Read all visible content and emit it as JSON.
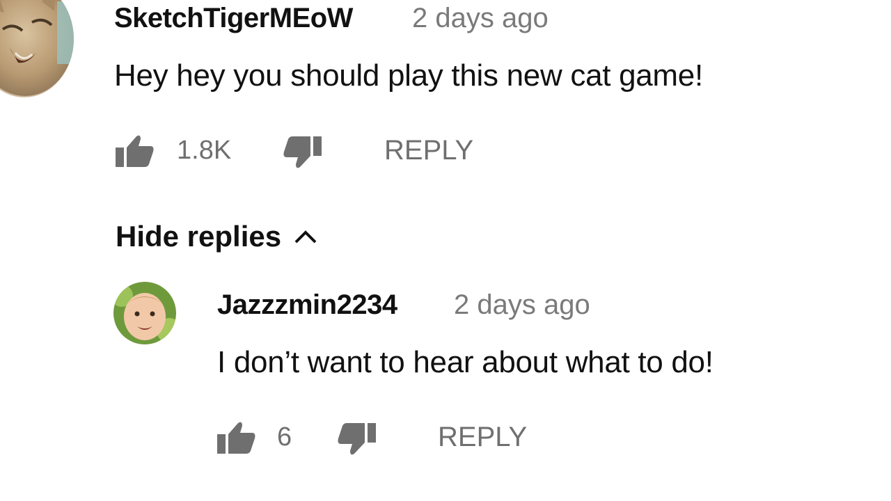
{
  "comment": {
    "author": "SketchTigerMEoW",
    "time": "2 days ago",
    "text": "Hey hey you should play this new cat game!",
    "likes": "1.8K",
    "reply_label": "REPLY",
    "avatar_icon": "cat-avatar-icon"
  },
  "replies_toggle": {
    "label": "Hide replies",
    "icon": "chevron-up-icon"
  },
  "reply": {
    "author": "Jazzzmin2234",
    "time": "2 days ago",
    "text": "I don’t want to hear about what to do!",
    "likes": "6",
    "reply_label": "REPLY",
    "avatar_icon": "baby-avatar-icon"
  },
  "colors": {
    "text_primary": "#111111",
    "text_secondary": "#7a7a7a",
    "icon_gray": "#6f6f6f"
  }
}
